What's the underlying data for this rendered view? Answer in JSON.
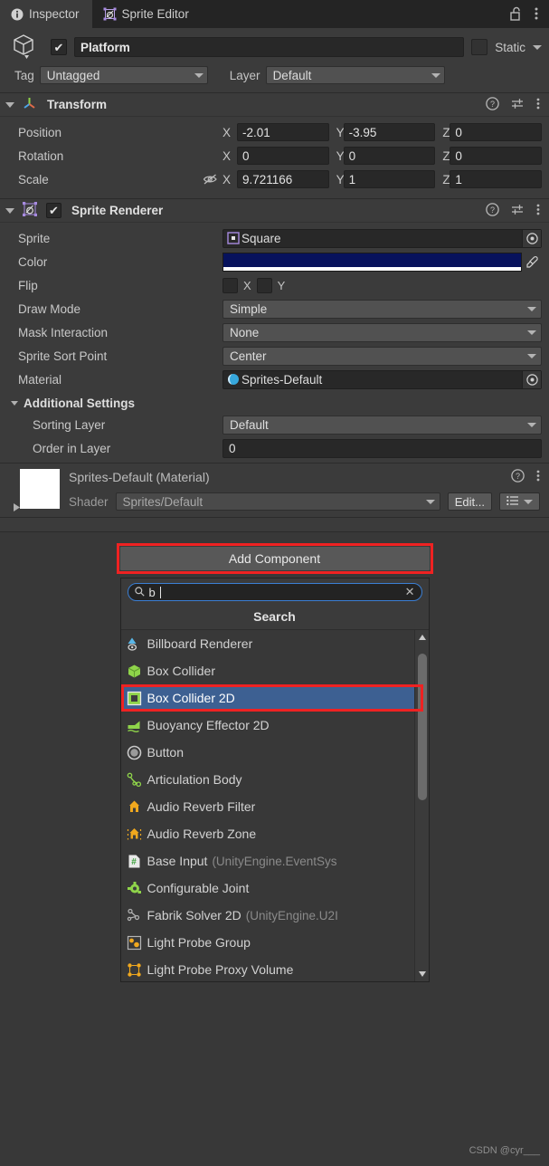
{
  "window": {
    "tabs": [
      {
        "label": "Inspector",
        "icon": "info-icon",
        "active": true
      },
      {
        "label": "Sprite Editor",
        "icon": "sprite-editor-icon",
        "active": false
      }
    ],
    "lock_icon": "padlock-open-icon",
    "menu_icon": "kebab-menu-icon"
  },
  "gameobject": {
    "icon": "cube-icon",
    "enabled": true,
    "name": "Platform",
    "static_label": "Static",
    "static_checked": false,
    "tag_label": "Tag",
    "tag_value": "Untagged",
    "layer_label": "Layer",
    "layer_value": "Default"
  },
  "transform": {
    "title": "Transform",
    "icon": "transform-axis-icon",
    "expanded": true,
    "header_icons": [
      "help-icon",
      "preset-icon",
      "kebab-menu-icon"
    ],
    "rows": [
      {
        "label": "Position",
        "x": "-2.01",
        "y": "-3.95",
        "z": "0",
        "locked_icon": ""
      },
      {
        "label": "Rotation",
        "x": "0",
        "y": "0",
        "z": "0",
        "locked_icon": ""
      },
      {
        "label": "Scale",
        "x": "9.721166",
        "y": "1",
        "z": "1",
        "locked_icon": "constrain-proportions-off-icon"
      }
    ],
    "axis_labels": {
      "x": "X",
      "y": "Y",
      "z": "Z"
    }
  },
  "sprite_renderer": {
    "title": "Sprite Renderer",
    "icon": "sprite-renderer-icon",
    "enabled": true,
    "expanded": true,
    "header_icons": [
      "help-icon",
      "preset-icon",
      "kebab-menu-icon"
    ],
    "sprite": {
      "label": "Sprite",
      "value": "Square",
      "icon": "sprite-asset-icon",
      "picker": "object-picker-icon"
    },
    "color": {
      "label": "Color",
      "hex": "#07125c",
      "alpha_hex": "#ffffff",
      "eyedropper": "eyedropper-icon"
    },
    "flip": {
      "label": "Flip",
      "x_label": "X",
      "y_label": "Y",
      "x_checked": false,
      "y_checked": false
    },
    "draw_mode": {
      "label": "Draw Mode",
      "value": "Simple"
    },
    "mask_interaction": {
      "label": "Mask Interaction",
      "value": "None"
    },
    "sprite_sort_point": {
      "label": "Sprite Sort Point",
      "value": "Center"
    },
    "material": {
      "label": "Material",
      "value": "Sprites-Default",
      "icon": "material-sphere-icon",
      "picker": "object-picker-icon"
    },
    "additional_settings": {
      "title": "Additional Settings",
      "sorting_layer": {
        "label": "Sorting Layer",
        "value": "Default"
      },
      "order_in_layer": {
        "label": "Order in Layer",
        "value": "0"
      }
    }
  },
  "material_block": {
    "title": "Sprites-Default (Material)",
    "swatch_hex": "#ffffff",
    "shader_label": "Shader",
    "shader_value": "Sprites/Default",
    "edit_button": "Edit...",
    "header_icons": [
      "help-icon",
      "kebab-menu-icon"
    ],
    "list_icon": "list-dropdown-icon"
  },
  "add_component": {
    "button_label": "Add Component",
    "highlight_color": "#ef2222",
    "search": {
      "icon": "search-icon",
      "value": "b",
      "clear_icon": "close-icon"
    },
    "popup_title": "Search",
    "selected_index": 2,
    "items": [
      {
        "name": "Billboard Renderer",
        "ns": "",
        "icon": "billboard-renderer-icon"
      },
      {
        "name": "Box Collider",
        "ns": "",
        "icon": "box-collider-icon"
      },
      {
        "name": "Box Collider 2D",
        "ns": "",
        "icon": "box-collider-2d-icon"
      },
      {
        "name": "Buoyancy Effector 2D",
        "ns": "",
        "icon": "buoyancy-effector-2d-icon"
      },
      {
        "name": "Button",
        "ns": "",
        "icon": "button-icon"
      },
      {
        "name": "Articulation Body",
        "ns": "",
        "icon": "articulation-body-icon"
      },
      {
        "name": "Audio Reverb Filter",
        "ns": "",
        "icon": "audio-reverb-filter-icon"
      },
      {
        "name": "Audio Reverb Zone",
        "ns": "",
        "icon": "audio-reverb-zone-icon"
      },
      {
        "name": "Base Input",
        "ns": "(UnityEngine.EventSys",
        "icon": "script-icon"
      },
      {
        "name": "Configurable Joint",
        "ns": "",
        "icon": "configurable-joint-icon"
      },
      {
        "name": "Fabrik Solver 2D",
        "ns": "(UnityEngine.U2I",
        "icon": "fabrik-solver-2d-icon"
      },
      {
        "name": "Light Probe Group",
        "ns": "",
        "icon": "light-probe-group-icon"
      },
      {
        "name": "Light Probe Proxy Volume",
        "ns": "",
        "icon": "light-probe-proxy-volume-icon"
      }
    ],
    "scrollbar": {
      "up_arrow": "arrow-up-icon",
      "down_arrow": "arrow-down-icon"
    }
  },
  "watermark": "CSDN @cyr___"
}
